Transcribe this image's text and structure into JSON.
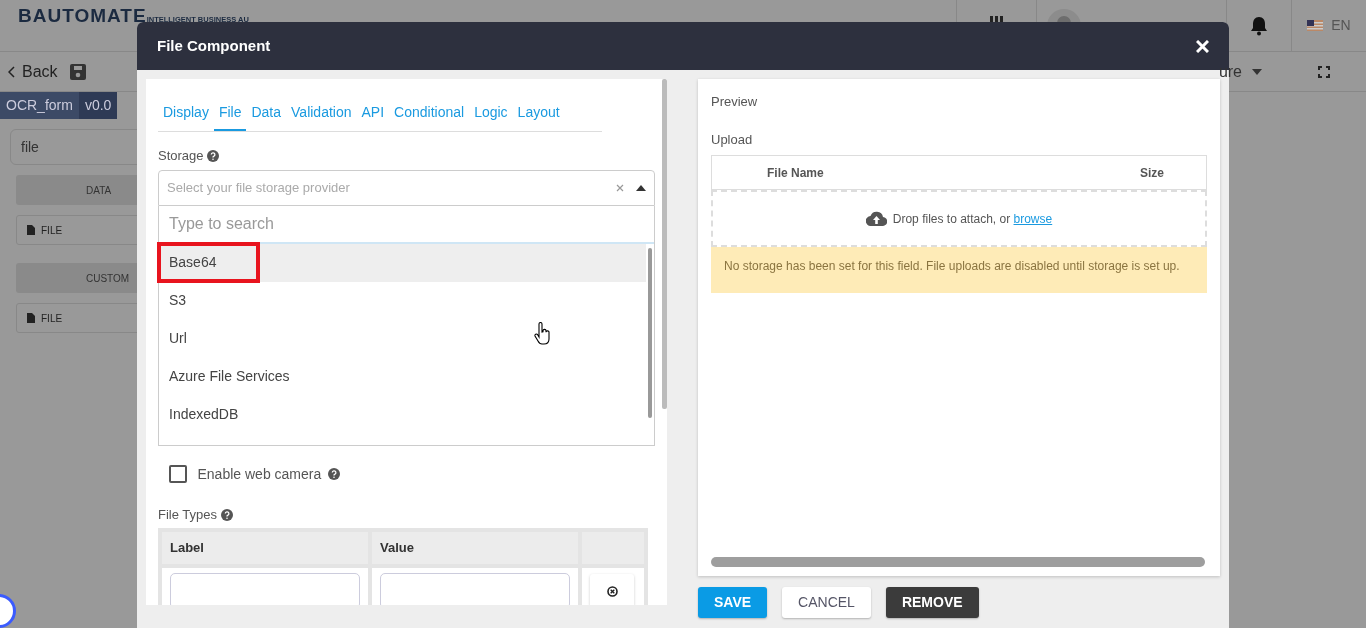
{
  "background_page": {
    "logo": "BAUTOMATE",
    "tagline": "INTELLIGENT BUSINESS AU",
    "back": "Back",
    "form_name": "OCR_form",
    "version": "v0.0",
    "search_value": "file",
    "groups": [
      {
        "header": "DATA",
        "items": [
          "FILE"
        ]
      },
      {
        "header": "CUSTOM",
        "items": [
          "FILE"
        ]
      }
    ],
    "menu_partial": "ure",
    "language": "EN"
  },
  "dialog": {
    "title": "File Component",
    "tabs": [
      {
        "label": "Display",
        "selected": false
      },
      {
        "label": "File",
        "selected": true
      },
      {
        "label": "Data",
        "selected": false
      },
      {
        "label": "Validation",
        "selected": false
      },
      {
        "label": "API",
        "selected": false
      },
      {
        "label": "Conditional",
        "selected": false
      },
      {
        "label": "Logic",
        "selected": false
      },
      {
        "label": "Layout",
        "selected": false
      }
    ],
    "storage": {
      "label": "Storage",
      "placeholder": "Select your file storage provider",
      "search_placeholder": "Type to search",
      "options": [
        {
          "label": "Base64",
          "highlighted": true
        },
        {
          "label": "S3",
          "highlighted": false
        },
        {
          "label": "Url",
          "highlighted": false
        },
        {
          "label": "Azure File Services",
          "highlighted": false
        },
        {
          "label": "IndexedDB",
          "highlighted": false
        }
      ]
    },
    "enable_web_camera": {
      "label": "Enable web camera",
      "checked": false
    },
    "file_types": {
      "label": "File Types",
      "columns": [
        "Label",
        "Value"
      ]
    },
    "preview": {
      "title": "Preview",
      "upload_label": "Upload",
      "columns": [
        "File Name",
        "Size"
      ],
      "drop_text": "Drop files to attach, or",
      "browse_link": "browse",
      "warning": "No storage has been set for this field. File uploads are disabled until storage is set up."
    },
    "buttons": [
      {
        "label": "SAVE",
        "kind": "primary"
      },
      {
        "label": "CANCEL",
        "kind": "secondary"
      },
      {
        "label": "REMOVE",
        "kind": "dark"
      }
    ]
  }
}
